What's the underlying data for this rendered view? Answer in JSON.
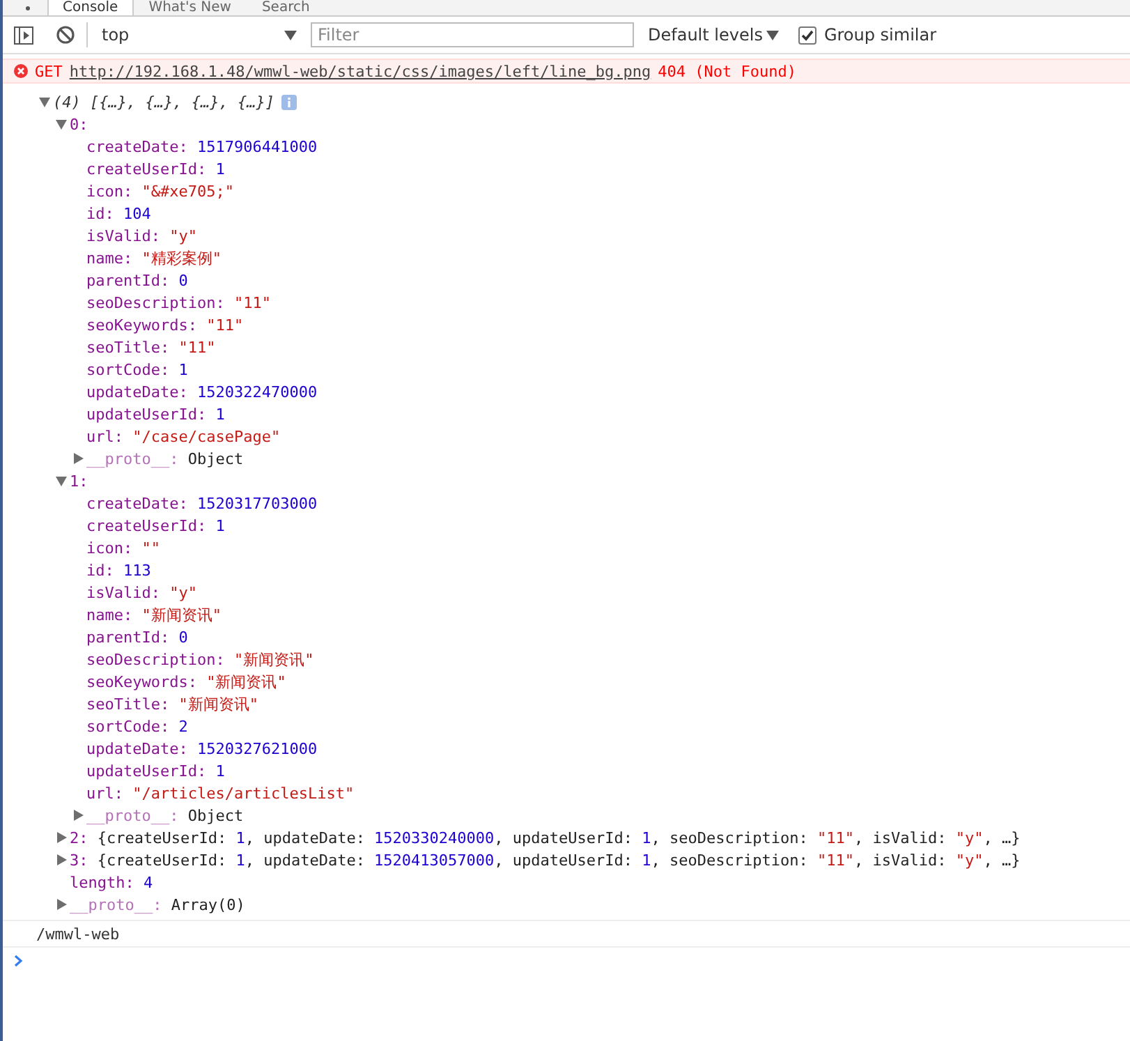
{
  "tabs": [
    {
      "label": "Console",
      "selected": true
    },
    {
      "label": "What's New",
      "selected": false
    },
    {
      "label": "Search",
      "selected": false
    }
  ],
  "toolbar": {
    "context": "top",
    "filter": {
      "placeholder": "Filter"
    },
    "levels": "Default levels",
    "group_similar": {
      "label": "Group similar",
      "checked": true
    }
  },
  "messages": [
    {
      "kind": "error",
      "method": "GET",
      "url": "http://192.168.1.48/wmwl-web/static/css/images/left/line_bg.png",
      "status": "404 (Not Found)"
    },
    {
      "kind": "object",
      "root": {
        "tokens": [
          {
            "kind": "summary",
            "text": "(4) [{…}, {…}, {…}, {…}]"
          }
        ],
        "expanded": true,
        "children": [
          {
            "tokens": [
              {
                "kind": "key",
                "text": "0:"
              }
            ],
            "expanded": true,
            "children": [
              {
                "tokens": [
                  {
                    "kind": "key",
                    "text": "createDate:"
                  },
                  {
                    "kind": "number",
                    "text": " 1517906441000"
                  }
                ]
              },
              {
                "tokens": [
                  {
                    "kind": "key",
                    "text": "createUserId:"
                  },
                  {
                    "kind": "number",
                    "text": " 1"
                  }
                ]
              },
              {
                "tokens": [
                  {
                    "kind": "key",
                    "text": "icon:"
                  },
                  {
                    "kind": "string",
                    "text": " \"&#xe705;\""
                  }
                ]
              },
              {
                "tokens": [
                  {
                    "kind": "key",
                    "text": "id:"
                  },
                  {
                    "kind": "number",
                    "text": " 104"
                  }
                ]
              },
              {
                "tokens": [
                  {
                    "kind": "key",
                    "text": "isValid:"
                  },
                  {
                    "kind": "string",
                    "text": " \"y\""
                  }
                ]
              },
              {
                "tokens": [
                  {
                    "kind": "key",
                    "text": "name:"
                  },
                  {
                    "kind": "string",
                    "text": " \"精彩案例\""
                  }
                ]
              },
              {
                "tokens": [
                  {
                    "kind": "key",
                    "text": "parentId:"
                  },
                  {
                    "kind": "number",
                    "text": " 0"
                  }
                ]
              },
              {
                "tokens": [
                  {
                    "kind": "key",
                    "text": "seoDescription:"
                  },
                  {
                    "kind": "string",
                    "text": " \"11\""
                  }
                ]
              },
              {
                "tokens": [
                  {
                    "kind": "key",
                    "text": "seoKeywords:"
                  },
                  {
                    "kind": "string",
                    "text": " \"11\""
                  }
                ]
              },
              {
                "tokens": [
                  {
                    "kind": "key",
                    "text": "seoTitle:"
                  },
                  {
                    "kind": "string",
                    "text": " \"11\""
                  }
                ]
              },
              {
                "tokens": [
                  {
                    "kind": "key",
                    "text": "sortCode:"
                  },
                  {
                    "kind": "number",
                    "text": " 1"
                  }
                ]
              },
              {
                "tokens": [
                  {
                    "kind": "key",
                    "text": "updateDate:"
                  },
                  {
                    "kind": "number",
                    "text": " 1520322470000"
                  }
                ]
              },
              {
                "tokens": [
                  {
                    "kind": "key",
                    "text": "updateUserId:"
                  },
                  {
                    "kind": "number",
                    "text": " 1"
                  }
                ]
              },
              {
                "tokens": [
                  {
                    "kind": "key",
                    "text": "url:"
                  },
                  {
                    "kind": "string",
                    "text": " \"/case/casePage\""
                  }
                ]
              },
              {
                "tokens": [
                  {
                    "kind": "proto",
                    "text": "__proto__:"
                  },
                  {
                    "kind": "plain",
                    "text": " Object"
                  }
                ],
                "expanded": false
              }
            ]
          },
          {
            "tokens": [
              {
                "kind": "key",
                "text": "1:"
              }
            ],
            "expanded": true,
            "children": [
              {
                "tokens": [
                  {
                    "kind": "key",
                    "text": "createDate:"
                  },
                  {
                    "kind": "number",
                    "text": " 1520317703000"
                  }
                ]
              },
              {
                "tokens": [
                  {
                    "kind": "key",
                    "text": "createUserId:"
                  },
                  {
                    "kind": "number",
                    "text": " 1"
                  }
                ]
              },
              {
                "tokens": [
                  {
                    "kind": "key",
                    "text": "icon:"
                  },
                  {
                    "kind": "string",
                    "text": " \"\""
                  }
                ]
              },
              {
                "tokens": [
                  {
                    "kind": "key",
                    "text": "id:"
                  },
                  {
                    "kind": "number",
                    "text": " 113"
                  }
                ]
              },
              {
                "tokens": [
                  {
                    "kind": "key",
                    "text": "isValid:"
                  },
                  {
                    "kind": "string",
                    "text": " \"y\""
                  }
                ]
              },
              {
                "tokens": [
                  {
                    "kind": "key",
                    "text": "name:"
                  },
                  {
                    "kind": "string",
                    "text": " \"新闻资讯\""
                  }
                ]
              },
              {
                "tokens": [
                  {
                    "kind": "key",
                    "text": "parentId:"
                  },
                  {
                    "kind": "number",
                    "text": " 0"
                  }
                ]
              },
              {
                "tokens": [
                  {
                    "kind": "key",
                    "text": "seoDescription:"
                  },
                  {
                    "kind": "string",
                    "text": " \"新闻资讯\""
                  }
                ]
              },
              {
                "tokens": [
                  {
                    "kind": "key",
                    "text": "seoKeywords:"
                  },
                  {
                    "kind": "string",
                    "text": " \"新闻资讯\""
                  }
                ]
              },
              {
                "tokens": [
                  {
                    "kind": "key",
                    "text": "seoTitle:"
                  },
                  {
                    "kind": "string",
                    "text": " \"新闻资讯\""
                  }
                ]
              },
              {
                "tokens": [
                  {
                    "kind": "key",
                    "text": "sortCode:"
                  },
                  {
                    "kind": "number",
                    "text": " 2"
                  }
                ]
              },
              {
                "tokens": [
                  {
                    "kind": "key",
                    "text": "updateDate:"
                  },
                  {
                    "kind": "number",
                    "text": " 1520327621000"
                  }
                ]
              },
              {
                "tokens": [
                  {
                    "kind": "key",
                    "text": "updateUserId:"
                  },
                  {
                    "kind": "number",
                    "text": " 1"
                  }
                ]
              },
              {
                "tokens": [
                  {
                    "kind": "key",
                    "text": "url:"
                  },
                  {
                    "kind": "string",
                    "text": " \"/articles/articlesList\""
                  }
                ]
              },
              {
                "tokens": [
                  {
                    "kind": "proto",
                    "text": "__proto__:"
                  },
                  {
                    "kind": "plain",
                    "text": " Object"
                  }
                ],
                "expanded": false
              }
            ]
          },
          {
            "tokens": [
              {
                "kind": "key",
                "text": "2:"
              },
              {
                "kind": "plain",
                "text": " {createUserId:"
              },
              {
                "kind": "number",
                "text": " 1"
              },
              {
                "kind": "plain",
                "text": ", updateDate:"
              },
              {
                "kind": "number",
                "text": " 1520330240000"
              },
              {
                "kind": "plain",
                "text": ", updateUserId:"
              },
              {
                "kind": "number",
                "text": " 1"
              },
              {
                "kind": "plain",
                "text": ", seoDescription:"
              },
              {
                "kind": "string",
                "text": " \"11\""
              },
              {
                "kind": "plain",
                "text": ", isValid:"
              },
              {
                "kind": "string",
                "text": " \"y\""
              },
              {
                "kind": "plain",
                "text": ", …}"
              }
            ],
            "expanded": false
          },
          {
            "tokens": [
              {
                "kind": "key",
                "text": "3:"
              },
              {
                "kind": "plain",
                "text": " {createUserId:"
              },
              {
                "kind": "number",
                "text": " 1"
              },
              {
                "kind": "plain",
                "text": ", updateDate:"
              },
              {
                "kind": "number",
                "text": " 1520413057000"
              },
              {
                "kind": "plain",
                "text": ", updateUserId:"
              },
              {
                "kind": "number",
                "text": " 1"
              },
              {
                "kind": "plain",
                "text": ", seoDescription:"
              },
              {
                "kind": "string",
                "text": " \"11\""
              },
              {
                "kind": "plain",
                "text": ", isValid:"
              },
              {
                "kind": "string",
                "text": " \"y\""
              },
              {
                "kind": "plain",
                "text": ", …}"
              }
            ],
            "expanded": false
          },
          {
            "tokens": [
              {
                "kind": "key",
                "text": "length:"
              },
              {
                "kind": "number",
                "text": " 4"
              }
            ]
          },
          {
            "tokens": [
              {
                "kind": "proto",
                "text": "__proto__:"
              },
              {
                "kind": "plain",
                "text": " Array(0)"
              }
            ],
            "expanded": false
          }
        ]
      }
    },
    {
      "kind": "log",
      "text": "/wmwl-web"
    }
  ]
}
